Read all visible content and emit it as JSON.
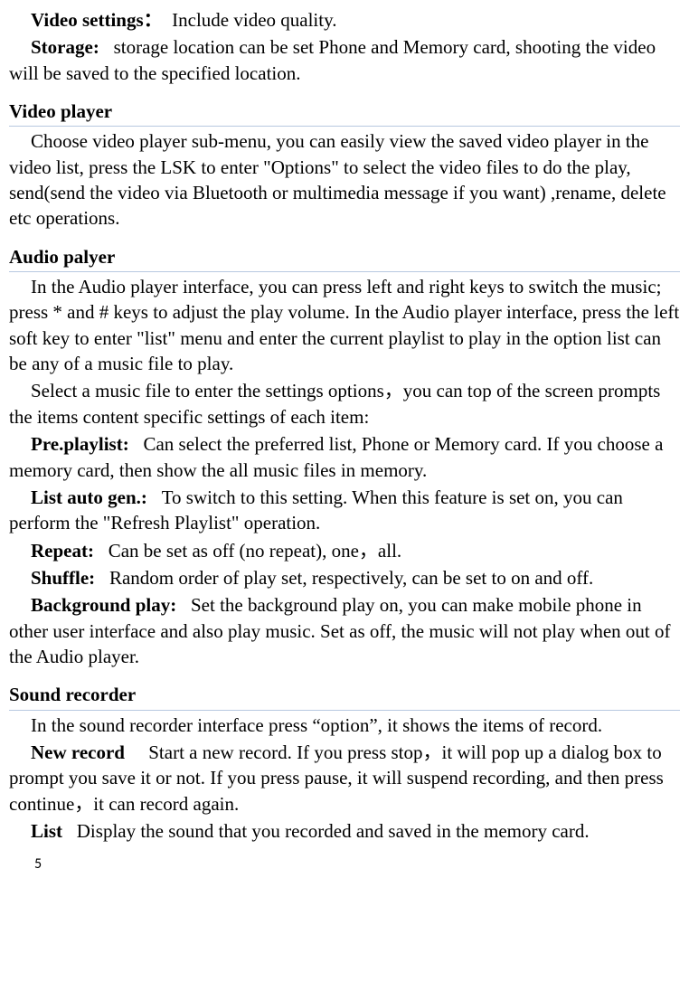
{
  "intro": {
    "videoSettings": {
      "label": "Video settings：",
      "text": "Include video quality."
    },
    "storage": {
      "label": "Storage:",
      "text": "storage location can be set Phone and Memory card, shooting the video will be saved to the specified location."
    }
  },
  "videoPlayer": {
    "heading": "Video player",
    "para": "Choose video player sub-menu, you can easily view the saved video player in the video list, press the LSK to enter \"Options\" to select the video files to do the play, send(send the video via Bluetooth or multimedia message if you want) ,rename, delete etc operations."
  },
  "audioPlayer": {
    "heading": "Audio palyer",
    "para1": "In the Audio player interface, you can press left and right keys to switch the music; press * and # keys to adjust the play volume. In the Audio player interface, press the left soft key to enter \"list\" menu and enter the current playlist to play in the option list can be any of a music file to play.",
    "para2": "Select a music file to enter the settings options，you can top of the screen prompts the items content specific settings of each item:",
    "prePlaylist": {
      "label": "Pre.playlist:",
      "text": "Can select the preferred list, Phone or Memory card. If you choose a memory card, then show the all music files in memory."
    },
    "listAutoGen": {
      "label": "List auto gen.:",
      "text": "To switch to this setting. When this feature is set on, you can perform the \"Refresh Playlist\" operation."
    },
    "repeat": {
      "label": "Repeat:",
      "text": "Can be set as off (no repeat), one，all."
    },
    "shuffle": {
      "label": "Shuffle:",
      "text": "Random order of play set, respectively, can be set to on and off."
    },
    "backgroundPlay": {
      "label": "Background play:",
      "text": "Set the background play on, you can make mobile phone in other user interface and also play music. Set as off, the music will not play when out of the Audio player."
    }
  },
  "soundRecorder": {
    "heading": "Sound recorder",
    "para": "In the sound recorder interface press “option”, it shows the items of record.",
    "newRecord": {
      "label": "New record",
      "text": "Start a new record. If you press stop，it will pop up a dialog box to prompt you save it or not. If you press pause, it will suspend recording, and then press continue，it can record again."
    },
    "list": {
      "label": "List",
      "text": "Display the sound that you recorded and saved in the memory card."
    }
  },
  "pageNumber": "5"
}
